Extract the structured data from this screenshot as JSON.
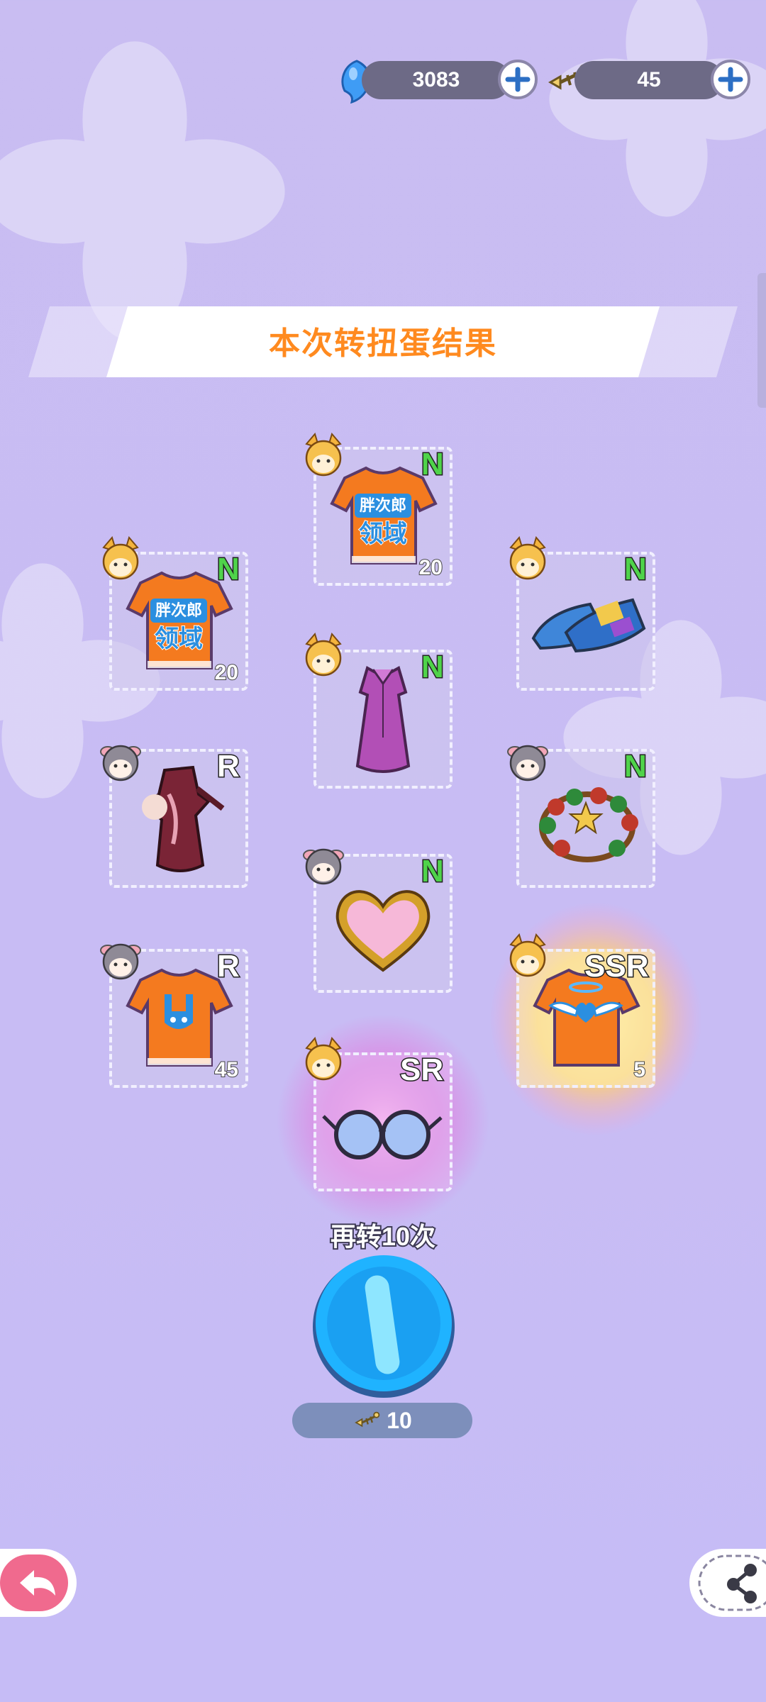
{
  "currency": {
    "gems": "3083",
    "tickets": "45"
  },
  "banner": {
    "title": "本次转扭蛋结果"
  },
  "results": [
    {
      "rarity": "N",
      "count": "20",
      "item": "orange-shirt-logo-icon"
    },
    {
      "rarity": "N",
      "count": "20",
      "item": "orange-shirt-logo-icon"
    },
    {
      "rarity": "N",
      "count": "",
      "item": "blue-sandals-icon"
    },
    {
      "rarity": "N",
      "count": "",
      "item": "purple-dress-icon"
    },
    {
      "rarity": "R",
      "count": "",
      "item": "qipao-outfit-icon"
    },
    {
      "rarity": "N",
      "count": "",
      "item": "bead-bracelet-icon"
    },
    {
      "rarity": "N",
      "count": "",
      "item": "heart-mirror-icon"
    },
    {
      "rarity": "R",
      "count": "45",
      "item": "bunny-shirt-icon"
    },
    {
      "rarity": "SSR",
      "count": "5",
      "item": "angel-heart-shirt-icon"
    },
    {
      "rarity": "SR",
      "count": "",
      "item": "round-glasses-icon"
    }
  ],
  "logo_text": {
    "line1": "胖次郎",
    "line2": "领域"
  },
  "spin_again": {
    "label": "再转10次",
    "cost": "10"
  },
  "colors": {
    "accent_title": "#ff8a1f",
    "rarity_n": "#4fd34a",
    "background": "#c9bdf2"
  }
}
